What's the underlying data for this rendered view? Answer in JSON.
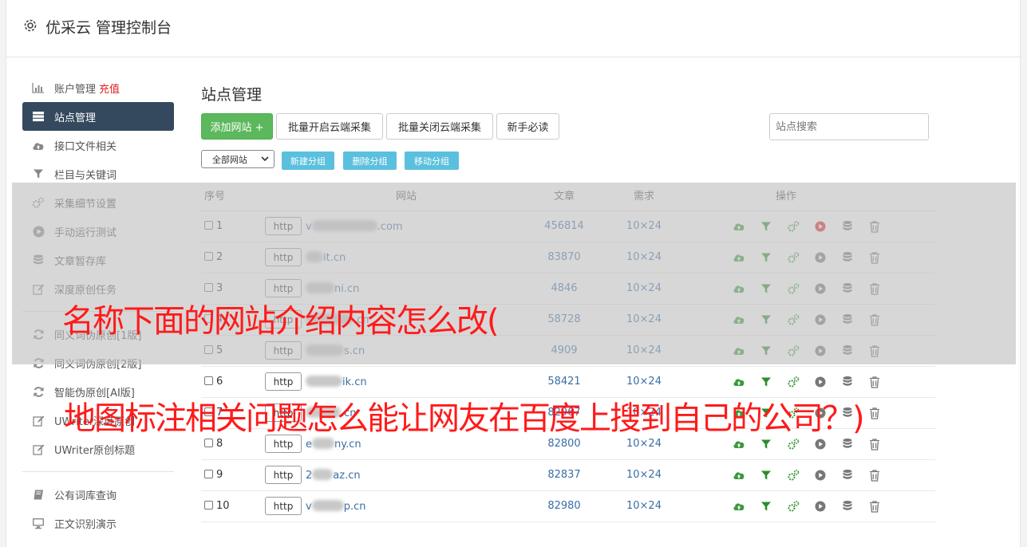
{
  "header": {
    "title": "优采云 管理控制台"
  },
  "sidebar": {
    "items": [
      {
        "label": "账户管理",
        "extra": "充值",
        "icon": "bar-chart-icon"
      },
      {
        "label": "站点管理",
        "icon": "server-list-icon",
        "active": true
      },
      {
        "label": "接口文件相关",
        "icon": "cloud-upload-icon"
      },
      {
        "label": "栏目与关键词",
        "icon": "filter-icon"
      },
      {
        "label": "采集细节设置",
        "icon": "gears-icon"
      },
      {
        "label": "手动运行测试",
        "icon": "play-circle-icon"
      },
      {
        "label": "文章暂存库",
        "icon": "database-icon"
      },
      {
        "label": "深度原创任务",
        "icon": "edit-icon"
      }
    ],
    "items2": [
      {
        "label": "同义词伪原创[1版]",
        "icon": "refresh-icon"
      },
      {
        "label": "同义词伪原创[2版]",
        "icon": "refresh-icon"
      },
      {
        "label": "智能伪原创[AI版]",
        "icon": "refresh-icon"
      },
      {
        "label": "UWriter深度原创",
        "icon": "edit-icon"
      },
      {
        "label": "UWriter原创标题",
        "icon": "edit-icon"
      }
    ],
    "items3": [
      {
        "label": "公有词库查询",
        "icon": "book-icon"
      },
      {
        "label": "正文识别演示",
        "icon": "monitor-icon"
      }
    ]
  },
  "main": {
    "title": "站点管理",
    "buttons": {
      "add": "添加网站 +",
      "batch_open": "批量开启云端采集",
      "batch_close": "批量关闭云端采集",
      "guide": "新手必读"
    },
    "search_placeholder": "站点搜索",
    "group_select": "全部网站",
    "group_buttons": {
      "new": "新建分组",
      "delete": "删除分组",
      "move": "移动分组"
    },
    "table": {
      "headers": {
        "no": "序号",
        "site": "网站",
        "articles": "文章",
        "demand": "需求",
        "ops": "操作"
      },
      "rows": [
        {
          "no": "1",
          "site_prefix": "v",
          "site_suffix": ".com",
          "articles": "456814",
          "demand": "10×24",
          "running": true
        },
        {
          "no": "2",
          "site_prefix": "",
          "site_suffix": "it.cn",
          "articles": "83870",
          "demand": "10×24"
        },
        {
          "no": "3",
          "site_prefix": "",
          "site_suffix": "ni.cn",
          "articles": "4846",
          "demand": "10×24"
        },
        {
          "no": "4",
          "site_prefix": "",
          "site_suffix": ".cn",
          "articles": "58728",
          "demand": "10×24"
        },
        {
          "no": "5",
          "site_prefix": "",
          "site_suffix": "s.cn",
          "articles": "4909",
          "demand": "10×24"
        },
        {
          "no": "6",
          "site_prefix": "",
          "site_suffix": "ik.cn",
          "articles": "58421",
          "demand": "10×24"
        },
        {
          "no": "7",
          "site_prefix": "",
          "site_suffix": ".cn",
          "articles": "82967",
          "demand": "10×24"
        },
        {
          "no": "8",
          "site_prefix": "e",
          "site_suffix": "ny.cn",
          "articles": "82800",
          "demand": "10×24"
        },
        {
          "no": "9",
          "site_prefix": "2",
          "site_suffix": "az.cn",
          "articles": "82837",
          "demand": "10×24"
        },
        {
          "no": "10",
          "site_prefix": "v",
          "site_suffix": "p.cn",
          "articles": "82980",
          "demand": "10×24"
        }
      ],
      "http_label": "http"
    }
  },
  "captions": {
    "line1": "名称下面的网站介绍内容怎么改(",
    "line2": "地图标注相关问题怎么能让网友在百度上搜到自己的公司？)"
  },
  "colors": {
    "active_nav": "#34495e",
    "green": "#5cb85c",
    "info": "#5bc0de",
    "caption": "#ff1a1a",
    "link": "#3a6ea5",
    "run_red": "#e02020"
  }
}
